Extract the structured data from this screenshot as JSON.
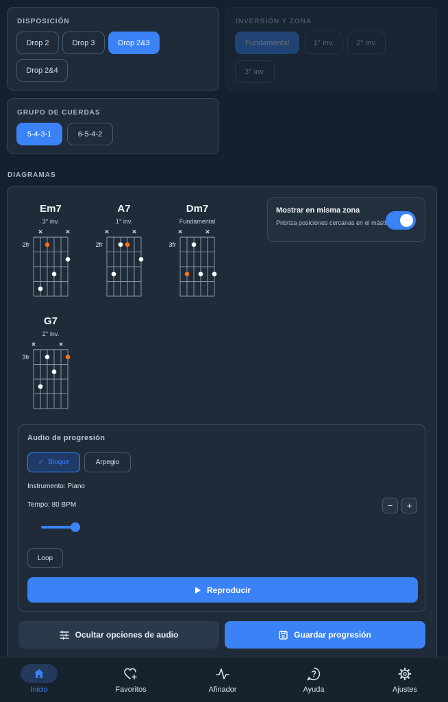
{
  "disposicion": {
    "title": "DISPOSICIÓN",
    "options": [
      "Drop 2",
      "Drop 3",
      "Drop 2&3",
      "Drop 2&4"
    ],
    "selected": "Drop 2&3"
  },
  "inversion": {
    "title": "INVERSIÓN Y ZONA",
    "options": [
      "Fundamental",
      "1° inv.",
      "2° inv.",
      "3° inv."
    ],
    "selected": "Fundamental",
    "disabled": true
  },
  "grupo": {
    "title": "GRUPO DE CUERDAS",
    "options": [
      "5-4-3-1",
      "6-5-4-2"
    ],
    "selected": "5-4-3-1"
  },
  "diagramas": {
    "label": "DIAGRAMAS",
    "chords": [
      {
        "name": "Em7",
        "inversion": "3° inv.",
        "fret_label": "2fr",
        "muted": [
          1,
          5
        ],
        "dots": [
          {
            "string": 2,
            "fret": 1,
            "root": true
          },
          {
            "string": 5,
            "fret": 2,
            "root": false
          },
          {
            "string": 3,
            "fret": 3,
            "root": false
          },
          {
            "string": 1,
            "fret": 4,
            "root": false
          }
        ]
      },
      {
        "name": "A7",
        "inversion": "1° inv.",
        "fret_label": "2fr",
        "muted": [
          0,
          4
        ],
        "dots": [
          {
            "string": 2,
            "fret": 1,
            "root": false
          },
          {
            "string": 3,
            "fret": 1,
            "root": true
          },
          {
            "string": 5,
            "fret": 2,
            "root": false
          },
          {
            "string": 1,
            "fret": 3,
            "root": false
          }
        ]
      },
      {
        "name": "Dm7",
        "inversion": "Fundamental",
        "fret_label": "3fr",
        "muted": [
          0,
          4
        ],
        "dots": [
          {
            "string": 2,
            "fret": 1,
            "root": false
          },
          {
            "string": 1,
            "fret": 3,
            "root": true
          },
          {
            "string": 3,
            "fret": 3,
            "root": false
          },
          {
            "string": 5,
            "fret": 3,
            "root": false
          }
        ]
      },
      {
        "name": "G7",
        "inversion": "2° inv.",
        "fret_label": "3fr",
        "muted": [
          0,
          4
        ],
        "dots": [
          {
            "string": 2,
            "fret": 1,
            "root": false
          },
          {
            "string": 5,
            "fret": 1,
            "root": true
          },
          {
            "string": 3,
            "fret": 2,
            "root": false
          },
          {
            "string": 1,
            "fret": 3,
            "root": false
          }
        ]
      }
    ]
  },
  "zona": {
    "title": "Mostrar en misma zona",
    "description": "Prioriza posiciones cercanas en el mástil",
    "enabled": true
  },
  "audio": {
    "title": "Audio de progresión",
    "modes": [
      "Bloque",
      "Arpegio"
    ],
    "selected_mode": "Bloque",
    "instrument": "Instrumento: Piano",
    "tempo": "Tempo: 80 BPM",
    "tempo_slider_fraction": 0.1,
    "minus": "−",
    "plus": "+",
    "loop": "Loop",
    "play": "Reproducir"
  },
  "actions": {
    "hide_audio": "Ocultar opciones de audio",
    "save": "Guardar progresión"
  },
  "nav": {
    "items": [
      {
        "label": "Inicio",
        "icon": "home-icon",
        "active": true
      },
      {
        "label": "Favoritos",
        "icon": "heart-plus-icon",
        "active": false
      },
      {
        "label": "Afinador",
        "icon": "pulse-icon",
        "active": false
      },
      {
        "label": "Ayuda",
        "icon": "help-icon",
        "active": false
      },
      {
        "label": "Ajustes",
        "icon": "gear-icon",
        "active": false
      }
    ]
  },
  "colors": {
    "accent": "#3b82f6",
    "root_dot": "#f97316",
    "background": "#13212e",
    "card": "#1f2b39"
  }
}
